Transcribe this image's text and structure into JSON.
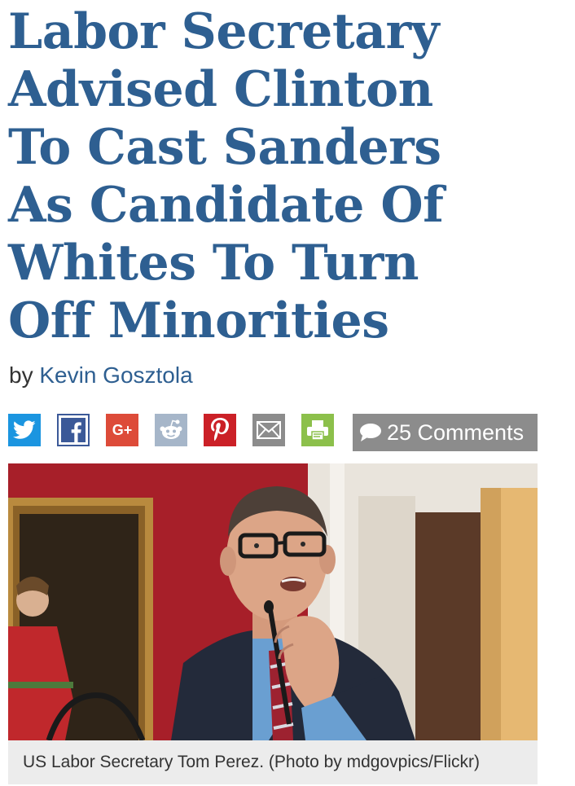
{
  "article": {
    "headline_lines": [
      "Labor Secretary",
      "Advised Clinton",
      "To Cast Sanders",
      "As Candidate Of",
      "Whites To Turn",
      "Off Minorities"
    ],
    "byline_prefix": "by",
    "author": "Kevin Gosztola"
  },
  "share": {
    "buttons": [
      {
        "name": "twitter",
        "icon": "twitter-icon",
        "color": "#1b95e0"
      },
      {
        "name": "facebook",
        "icon": "facebook-icon",
        "color": "#3b5998"
      },
      {
        "name": "google-plus",
        "icon": "google-plus-icon",
        "label": "G+",
        "color": "#dd4b39"
      },
      {
        "name": "reddit",
        "icon": "reddit-icon",
        "color": "#a6b6c9"
      },
      {
        "name": "pinterest",
        "icon": "pinterest-icon",
        "color": "#cb2027"
      },
      {
        "name": "email",
        "icon": "email-icon",
        "color": "#8c8c8c"
      },
      {
        "name": "print",
        "icon": "print-icon",
        "color": "#8cc04b"
      }
    ],
    "comments_label": "25 Comments"
  },
  "photo": {
    "caption": "US Labor Secretary Tom Perez. (Photo by mdgovpics/Flickr)"
  },
  "colors": {
    "headline": "#2e5f91",
    "link": "#2e5f91",
    "comments_bg": "#8c8c8c",
    "caption_bg": "#ececec"
  }
}
